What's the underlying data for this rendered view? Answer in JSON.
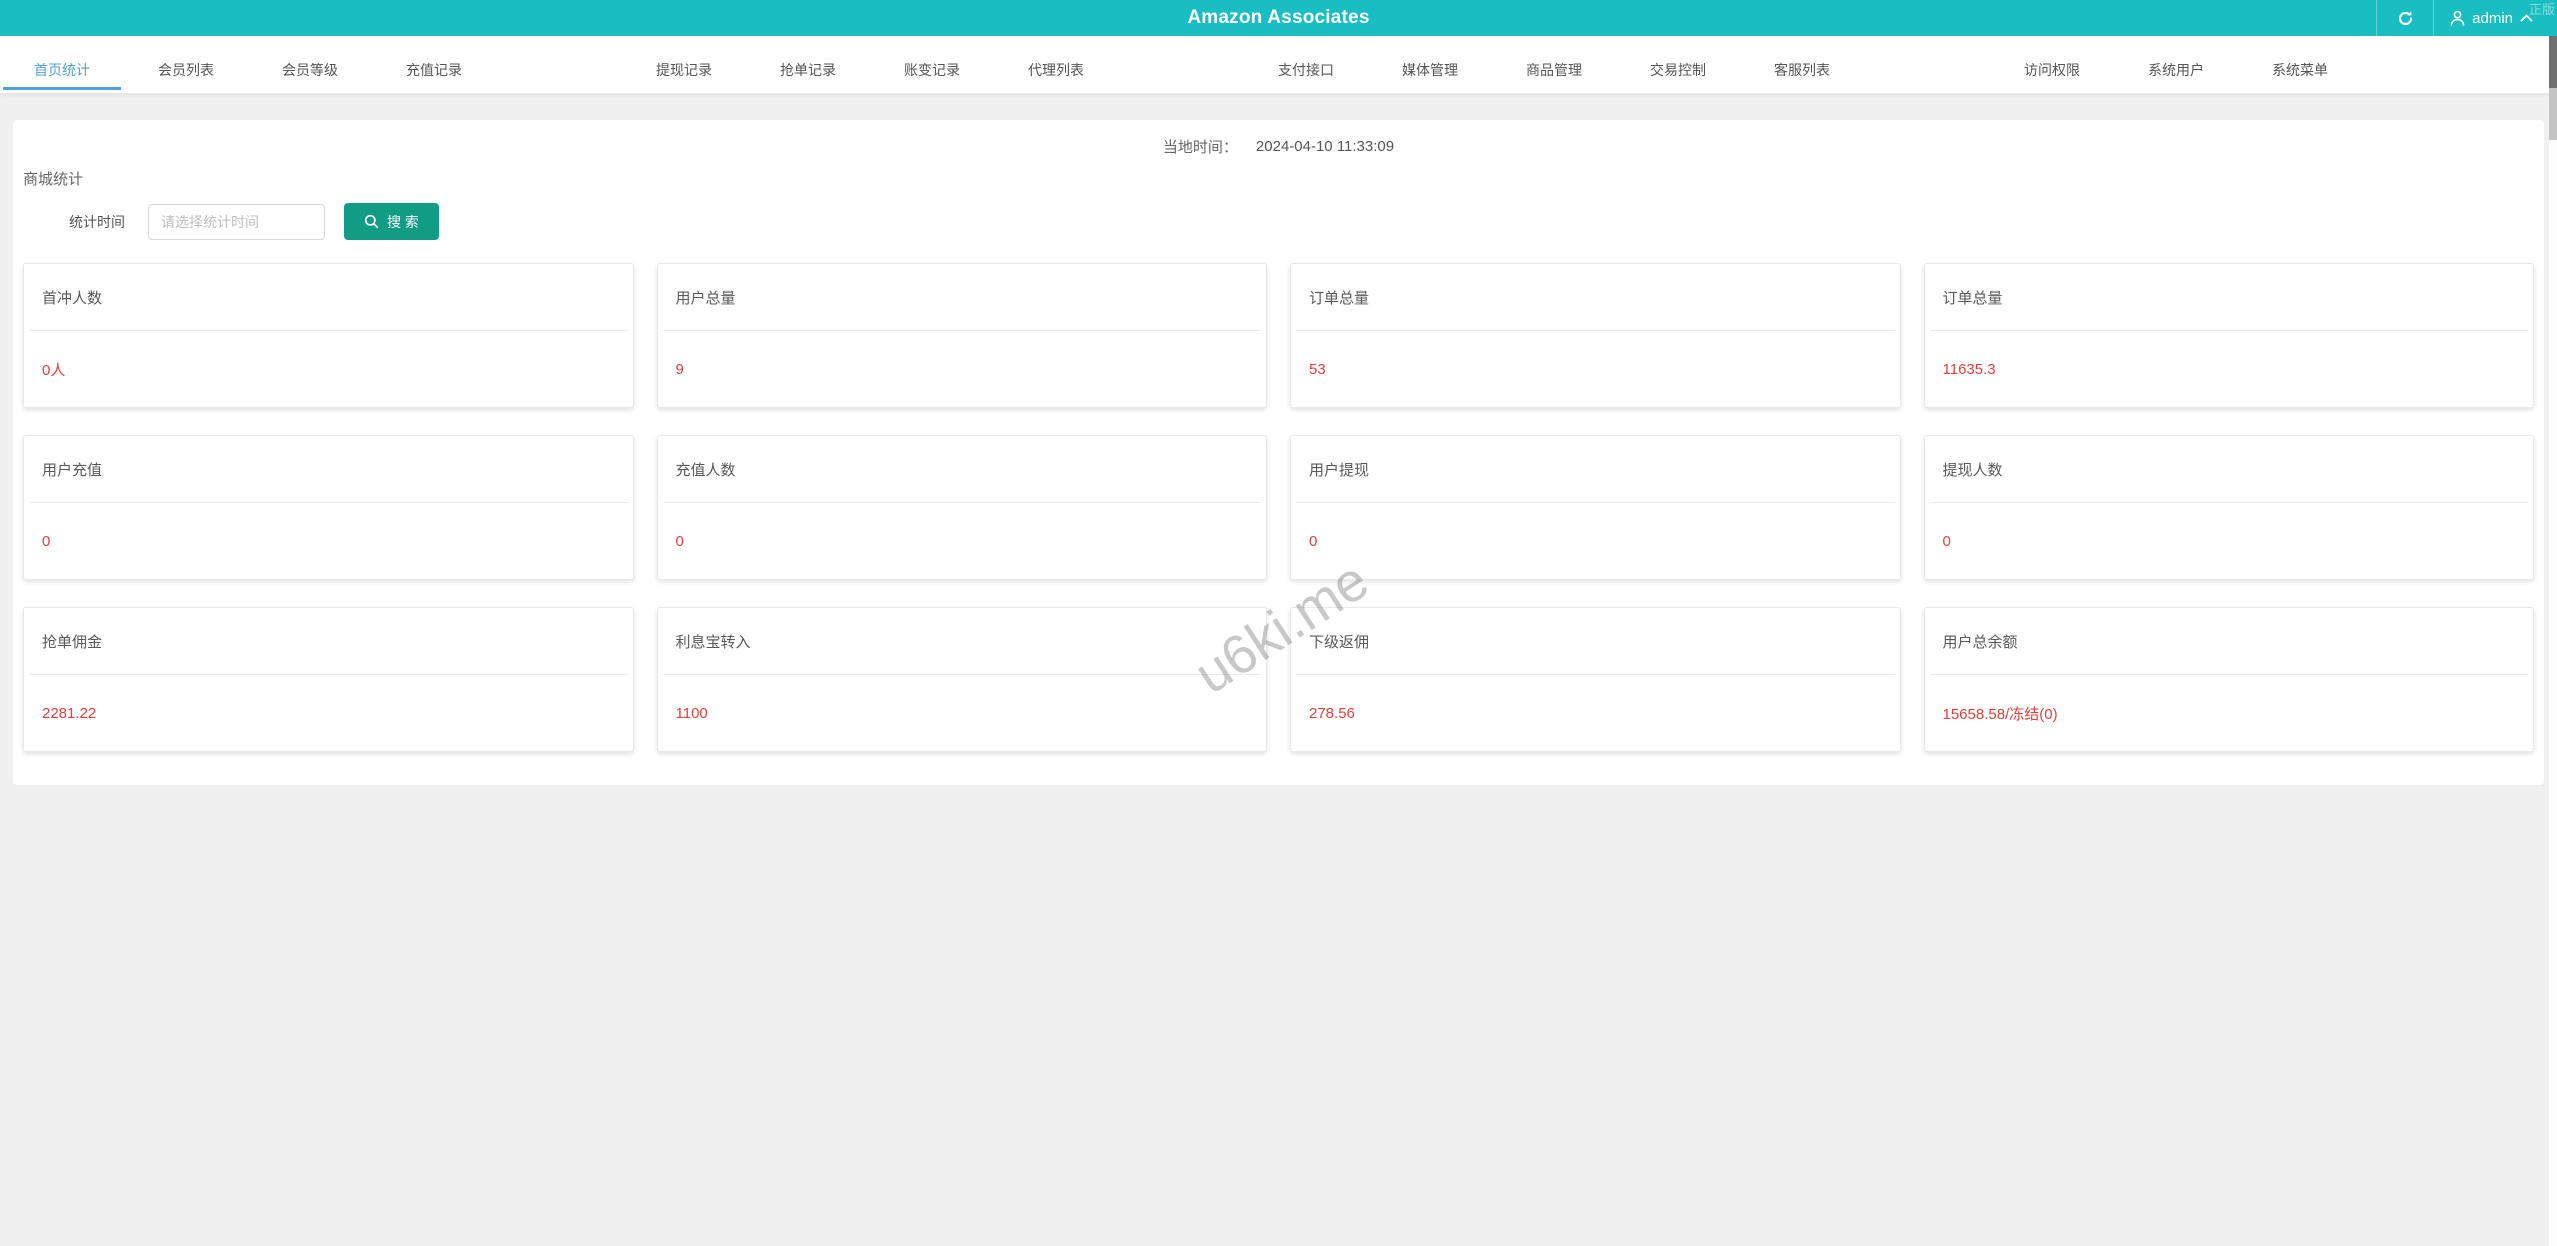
{
  "header": {
    "title": "Amazon Associates",
    "username": "admin",
    "corner_watermark": "正版",
    "icons": [
      "refresh-icon",
      "user-icon",
      "chevron-up-icon"
    ]
  },
  "nav": {
    "tabs": [
      {
        "label": "首页统计",
        "active": true
      },
      {
        "label": "会员列表",
        "active": false
      },
      {
        "label": "会员等级",
        "active": false
      },
      {
        "label": "充值记录",
        "active": false
      },
      {
        "label": "提现记录",
        "active": false
      },
      {
        "label": "抢单记录",
        "active": false
      },
      {
        "label": "账变记录",
        "active": false
      },
      {
        "label": "代理列表",
        "active": false
      },
      {
        "label": "支付接口",
        "active": false
      },
      {
        "label": "媒体管理",
        "active": false
      },
      {
        "label": "商品管理",
        "active": false
      },
      {
        "label": "交易控制",
        "active": false
      },
      {
        "label": "客服列表",
        "active": false
      },
      {
        "label": "访问权限",
        "active": false
      },
      {
        "label": "系统用户",
        "active": false
      },
      {
        "label": "系统菜单",
        "active": false
      }
    ]
  },
  "toolbar": {
    "local_time_label": "当地时间：",
    "local_time_value": "2024-04-10 11:33:09",
    "section_title": "商城统计",
    "stat_time_label": "统计时间",
    "stat_time_placeholder": "请选择统计时间",
    "stat_time_value": "",
    "search_button_label": "搜 索"
  },
  "cards": [
    {
      "title": "首冲人数",
      "value": "0人"
    },
    {
      "title": "用户总量",
      "value": "9"
    },
    {
      "title": "订单总量",
      "value": "53"
    },
    {
      "title": "订单总量",
      "value": "11635.3"
    },
    {
      "title": "用户充值",
      "value": "0"
    },
    {
      "title": "充值人数",
      "value": "0"
    },
    {
      "title": "用户提现",
      "value": "0"
    },
    {
      "title": "提现人数",
      "value": "0"
    },
    {
      "title": "抢单佣金",
      "value": "2281.22"
    },
    {
      "title": "利息宝转入",
      "value": "1100"
    },
    {
      "title": "下级返佣",
      "value": "278.56"
    },
    {
      "title": "用户总余额",
      "value": "15658.58/冻结(0)"
    }
  ],
  "watermark": "u6ki.me",
  "colors": {
    "header_teal": "#19bec3",
    "active_tab_blue": "#50a0dc",
    "search_button_green": "#119c86",
    "value_red": "#e0413c",
    "page_background": "#f0f0f0"
  }
}
